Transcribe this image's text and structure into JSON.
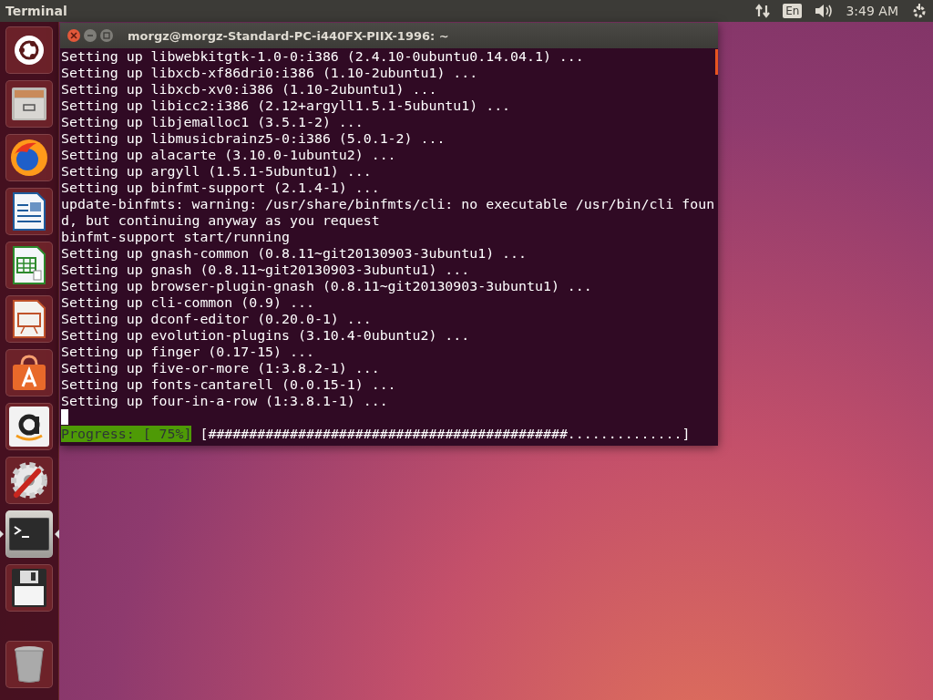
{
  "top_bar": {
    "app_title": "Terminal",
    "keyboard_layout": "En",
    "clock": "3:49 AM"
  },
  "launcher": [
    {
      "kind": "dash",
      "selected": false
    },
    {
      "kind": "files",
      "selected": false
    },
    {
      "kind": "browser",
      "selected": false
    },
    {
      "kind": "writer",
      "selected": false
    },
    {
      "kind": "calc",
      "selected": false
    },
    {
      "kind": "impress",
      "selected": false
    },
    {
      "kind": "store",
      "selected": false
    },
    {
      "kind": "amazon",
      "selected": false
    },
    {
      "kind": "settings",
      "selected": false
    },
    {
      "kind": "terminal",
      "selected": true
    },
    {
      "kind": "disk",
      "selected": false
    },
    {
      "kind": "trash",
      "selected": false
    }
  ],
  "window": {
    "title": "morgz@morgz-Standard-PC-i440FX-PIIX-1996: ~",
    "lines": [
      "Setting up libwebkitgtk-1.0-0:i386 (2.4.10-0ubuntu0.14.04.1) ...",
      "Setting up libxcb-xf86dri0:i386 (1.10-2ubuntu1) ...",
      "Setting up libxcb-xv0:i386 (1.10-2ubuntu1) ...",
      "Setting up libicc2:i386 (2.12+argyll1.5.1-5ubuntu1) ...",
      "Setting up libjemalloc1 (3.5.1-2) ...",
      "Setting up libmusicbrainz5-0:i386 (5.0.1-2) ...",
      "Setting up alacarte (3.10.0-1ubuntu2) ...",
      "Setting up argyll (1.5.1-5ubuntu1) ...",
      "Setting up binfmt-support (2.1.4-1) ...",
      "update-binfmts: warning: /usr/share/binfmts/cli: no executable /usr/bin/cli foun",
      "d, but continuing anyway as you request",
      "binfmt-support start/running",
      "Setting up gnash-common (0.8.11~git20130903-3ubuntu1) ...",
      "Setting up gnash (0.8.11~git20130903-3ubuntu1) ...",
      "Setting up browser-plugin-gnash (0.8.11~git20130903-3ubuntu1) ...",
      "Setting up cli-common (0.9) ...",
      "Setting up dconf-editor (0.20.0-1) ...",
      "Setting up evolution-plugins (3.10.4-0ubuntu2) ...",
      "Setting up finger (0.17-15) ...",
      "Setting up five-or-more (1:3.8.2-1) ...",
      "Setting up fonts-cantarell (0.0.15-1) ...",
      "Setting up four-in-a-row (1:3.8.1-1) ..."
    ],
    "progress_label": "Progress: [ 75%]",
    "progress_bar": "[############################################..............]"
  }
}
